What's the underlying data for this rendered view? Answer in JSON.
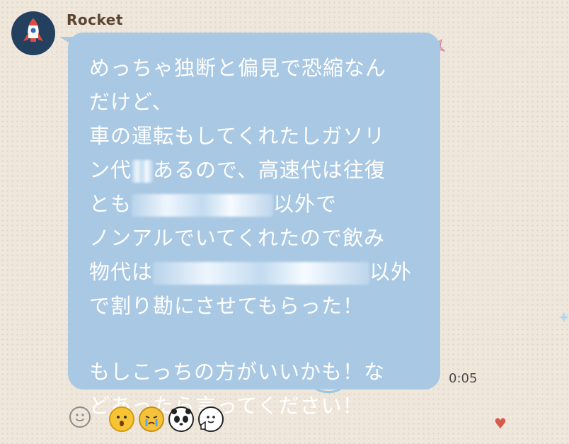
{
  "chat": {
    "sender_name": "Rocket",
    "avatar_icon": "rocket-icon",
    "timestamp": "0:05",
    "message_lines": {
      "l1": "めっちゃ独断と偏見で恐縮なん",
      "l2": "だけど、",
      "l3": "車の運転もしてくれたしガソリ",
      "l4_a": "ン代",
      "l4_b": "あるので、高速代は往復",
      "l5_a": "とも",
      "l5_b": "以外で",
      "l6": "ノンアルでいてくれたので飲み",
      "l7_a": "物代は",
      "l7_b": "以外",
      "l8": "で割り勘にさせてもらった！",
      "l9": "もしこっちの方がいいかも！な",
      "l10": "どあったら言ってください！"
    },
    "reaction_bar": {
      "add_reaction_icon": "smiley-outline-icon",
      "stickers": [
        "surprised-face-sticker",
        "crying-face-sticker",
        "panda-sticker",
        "thumbs-up-face-sticker"
      ]
    }
  },
  "colors": {
    "background": "#efe7db",
    "bubble": "#a9c8e3",
    "message_text": "#ffffff",
    "sender_text": "#5a4330",
    "timestamp_text": "#4a4a4a",
    "avatar_bg": "#24405f"
  }
}
